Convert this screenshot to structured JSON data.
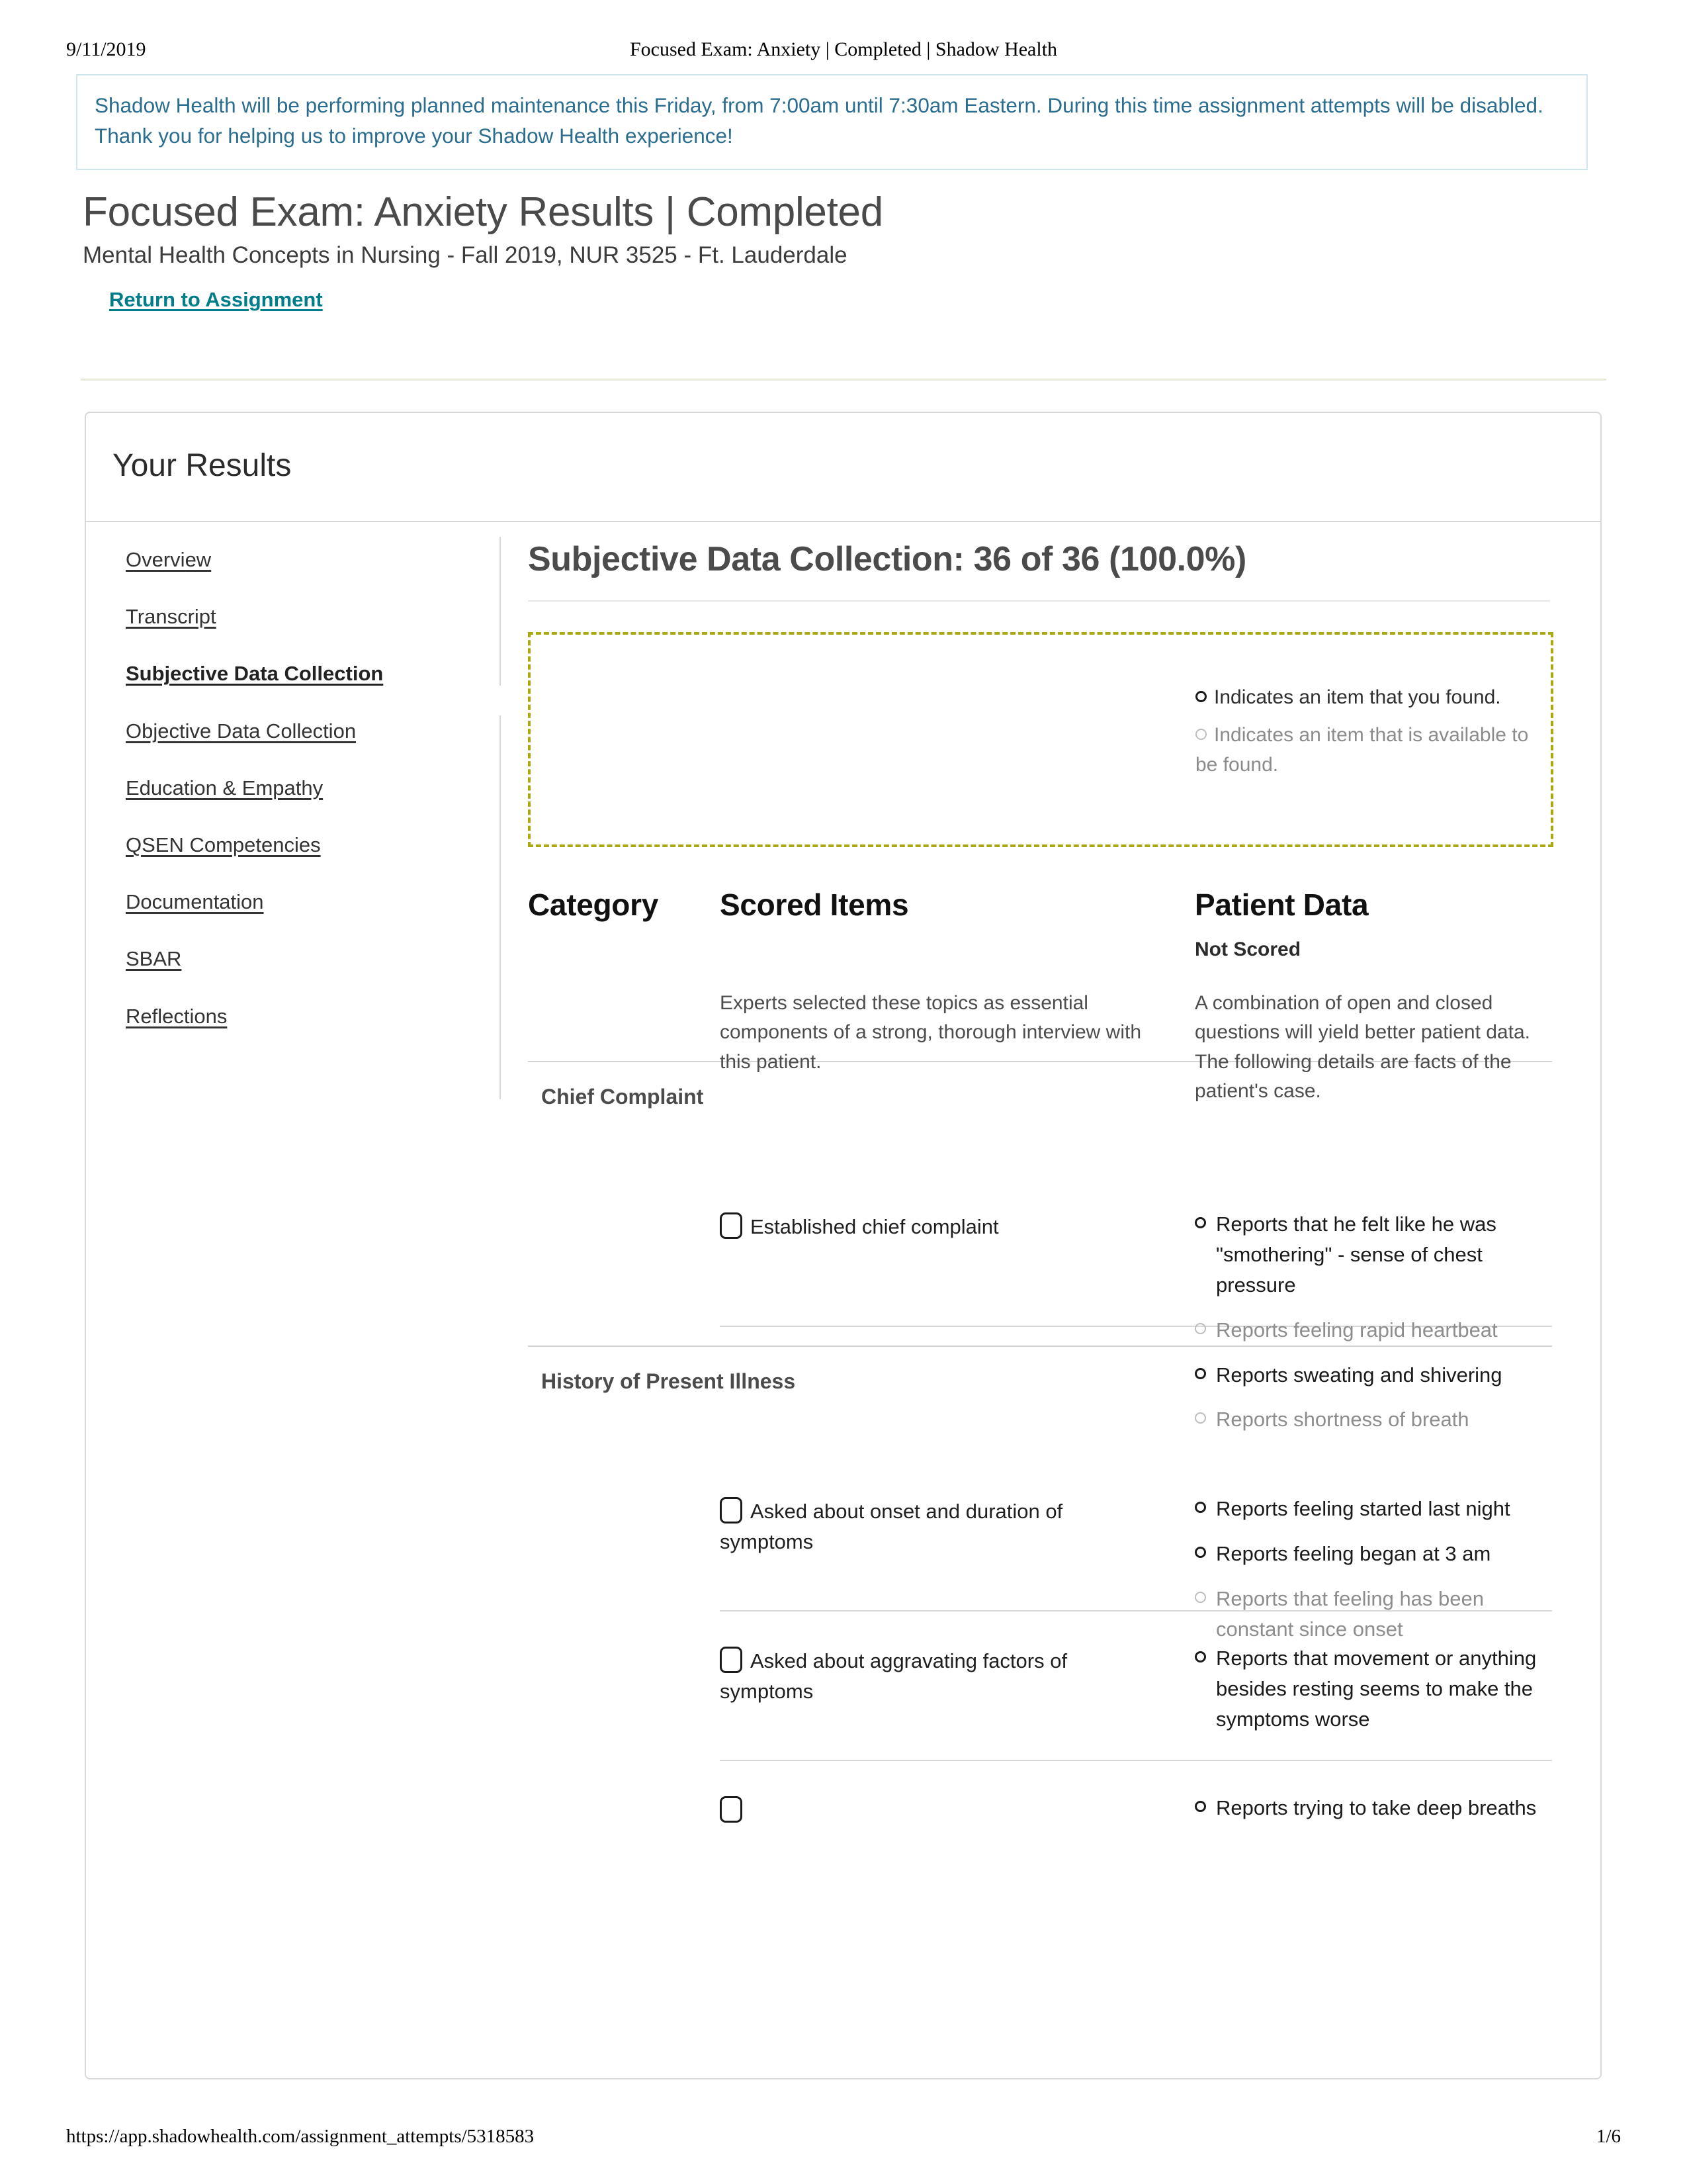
{
  "print_header": {
    "date": "9/11/2019",
    "title": "Focused Exam: Anxiety | Completed | Shadow Health"
  },
  "print_footer": {
    "url": "https://app.shadowhealth.com/assignment_attempts/5318583",
    "page": "1/6"
  },
  "banner": {
    "message": "Shadow Health will be performing planned maintenance this Friday, from 7:00am until 7:30am Eastern. During this time assignment attempts will be disabled. Thank you for helping us to improve your Shadow Health experience!",
    "border_color": "#cfe6ef",
    "text_color": "#2a6d8e"
  },
  "header": {
    "title": "Focused Exam: Anxiety Results | Completed",
    "subtitle": "Mental Health Concepts in Nursing - Fall 2019, NUR 3525 - Ft. Lauderdale",
    "return_link": "Return to Assignment",
    "link_color": "#007d8a"
  },
  "results_card": {
    "title": "Your Results"
  },
  "sidebar": {
    "items": [
      {
        "label": "Overview",
        "active": false
      },
      {
        "label": "Transcript",
        "active": false
      },
      {
        "label": "Subjective Data Collection",
        "active": true
      },
      {
        "label": "Objective Data Collection",
        "active": false
      },
      {
        "label": "Education & Empathy",
        "active": false
      },
      {
        "label": "QSEN Competencies",
        "active": false
      },
      {
        "label": "Documentation",
        "active": false
      },
      {
        "label": "SBAR",
        "active": false
      },
      {
        "label": "Reflections",
        "active": false
      }
    ]
  },
  "main": {
    "section_heading": "Subjective Data Collection: 36 of 36 (100.0%)",
    "legend": {
      "border_color": "#aaa811",
      "found": "Indicates an item that you found.",
      "available": "Indicates an item that is available to be found."
    },
    "table": {
      "columns": {
        "category": "Category",
        "scored_items": "Scored Items",
        "patient_data": "Patient Data"
      },
      "not_scored_label": "Not Scored",
      "scored_items_intro": "Experts selected these topics as essential components of a strong, thorough interview with this patient.",
      "patient_data_intro": "A combination of open and closed questions will yield better patient data. The following details are facts of the patient's case.",
      "categories": [
        {
          "name": "Chief Complaint",
          "rows": [
            {
              "scored_label": "Established chief complaint",
              "checked": false,
              "patient_data": [
                {
                  "text": "Reports that he felt like he was \"smothering\" - sense of chest pressure",
                  "found": true
                },
                {
                  "text": "Reports feeling rapid heartbeat",
                  "found": false
                },
                {
                  "text": "Reports sweating and shivering",
                  "found": true
                },
                {
                  "text": "Reports shortness of breath",
                  "found": false
                }
              ]
            }
          ]
        },
        {
          "name": "History of Present Illness",
          "rows": [
            {
              "scored_label": "Asked about onset and duration of symptoms",
              "checked": false,
              "patient_data": [
                {
                  "text": "Reports feeling started last night",
                  "found": true
                },
                {
                  "text": "Reports feeling began at 3 am",
                  "found": true
                },
                {
                  "text": "Reports that feeling has been constant since onset",
                  "found": false
                }
              ]
            },
            {
              "scored_label": "Asked about aggravating factors of symptoms",
              "checked": false,
              "patient_data": [
                {
                  "text": "Reports that movement or anything besides resting seems to make the symptoms worse",
                  "found": true
                }
              ]
            },
            {
              "scored_label": "",
              "checked": false,
              "patient_data": [
                {
                  "text": "Reports trying to take deep breaths",
                  "found": true
                }
              ]
            }
          ]
        }
      ]
    }
  }
}
